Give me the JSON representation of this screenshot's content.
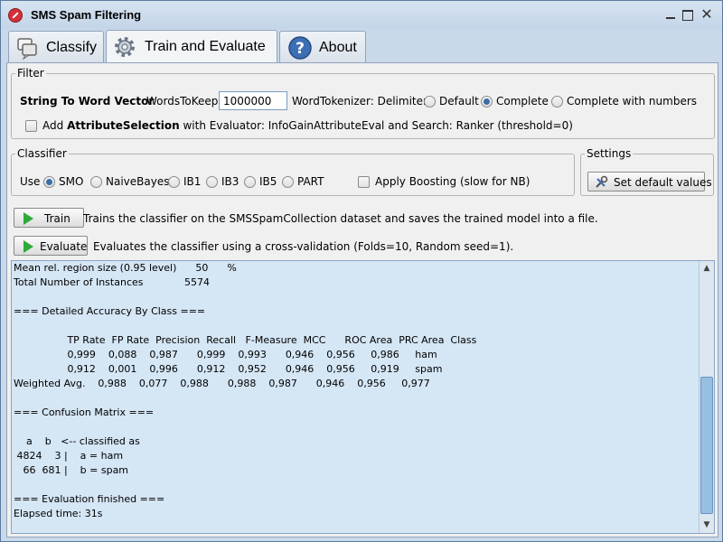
{
  "window": {
    "title": "SMS Spam Filtering",
    "close_glyph": "✕"
  },
  "tabs": [
    {
      "label": "Classify",
      "icon": "chat-bubbles-icon"
    },
    {
      "label": "Train and Evaluate",
      "icon": "gear-icon"
    },
    {
      "label": "About",
      "icon": "question-icon"
    }
  ],
  "filter": {
    "legend": "Filter",
    "method_label": "String To Word Vector",
    "words_to_keep_label": "WordsToKeep",
    "words_to_keep_value": "1000000",
    "tokenizer_label": "WordTokenizer: Delimiters",
    "delimiter_options": [
      "Default",
      "Complete",
      "Complete with numbers"
    ],
    "selected_delimiter": "Complete",
    "attr_sel_prefix": "Add",
    "attr_sel_bold": "AttributeSelection",
    "attr_sel_suffix": "with Evaluator: InfoGainAttributeEval and Search: Ranker (threshold=0)"
  },
  "classifier": {
    "legend": "Classifier",
    "use_label": "Use",
    "options": [
      "SMO",
      "NaiveBayes",
      "IB1",
      "IB3",
      "IB5",
      "PART"
    ],
    "selected": "SMO",
    "boosting_label": "Apply Boosting (slow for NB)"
  },
  "settings": {
    "legend": "Settings",
    "default_button": "Set default values"
  },
  "train": {
    "button": "Train",
    "description": "Trains the classifier on the SMSSpamCollection dataset and saves the trained model into a file."
  },
  "evaluate": {
    "button": "Evaluate",
    "description": "Evaluates the classifier using a cross-validation (Folds=10, Random seed=1)."
  },
  "output": {
    "lines": [
      "Mean rel. region size (0.95 level)      50      %",
      "Total Number of Instances             5574",
      "",
      "=== Detailed Accuracy By Class ===",
      "",
      "                 TP Rate  FP Rate  Precision  Recall   F-Measure  MCC      ROC Area  PRC Area  Class",
      "                 0,999    0,088    0,987      0,999    0,993      0,946    0,956     0,986     ham",
      "                 0,912    0,001    0,996      0,912    0,952      0,946    0,956     0,919     spam",
      "Weighted Avg.    0,988    0,077    0,988      0,988    0,987      0,946    0,956     0,977",
      "",
      "=== Confusion Matrix ===",
      "",
      "    a    b   <-- classified as",
      " 4824    3 |    a = ham",
      "   66  681 |    b = spam",
      "",
      "=== Evaluation finished ===",
      "Elapsed time: 31s"
    ]
  }
}
